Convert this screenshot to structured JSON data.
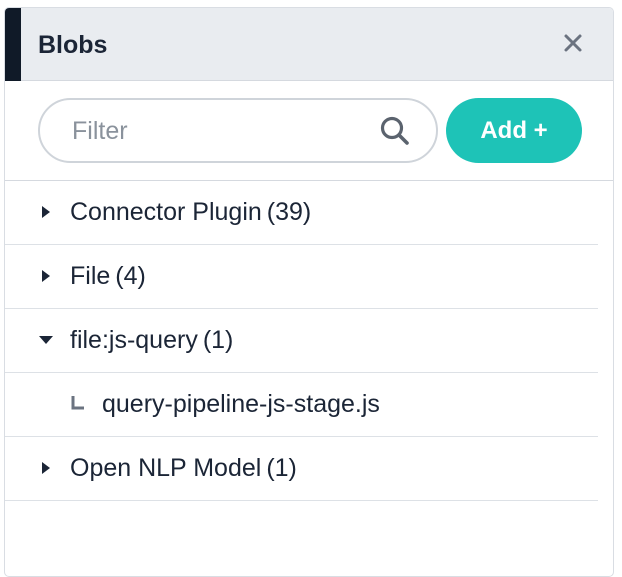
{
  "panel": {
    "title": "Blobs",
    "close_icon": "close-icon"
  },
  "toolbar": {
    "filter_placeholder": "Filter",
    "filter_value": "",
    "search_icon": "search-icon",
    "add_label": "Add +"
  },
  "colors": {
    "accent": "#1ec3b7",
    "header_bg": "#e9ecf0",
    "header_accent": "#101a28",
    "text": "#1b2536"
  },
  "tree": {
    "items": [
      {
        "label": "Connector Plugin",
        "count": "(39)",
        "expanded": false
      },
      {
        "label": "File",
        "count": "(4)",
        "expanded": false
      },
      {
        "label": "file:js-query",
        "count": "(1)",
        "expanded": true
      },
      {
        "label": "query-pipeline-js-stage.js"
      },
      {
        "label": "Open NLP Model",
        "count": "(1)",
        "expanded": false
      }
    ]
  }
}
